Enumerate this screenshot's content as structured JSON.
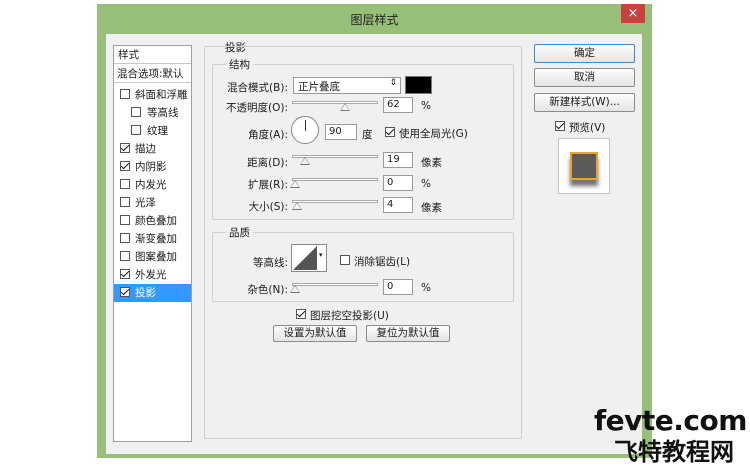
{
  "window": {
    "title": "图层样式",
    "close_glyph": "×",
    "frame_color": "#97bf79",
    "close_color": "#c9413e"
  },
  "style_list": {
    "header": "样式",
    "blend_options": "混合选项:默认",
    "items": [
      {
        "label": "斜面和浮雕",
        "checked": false,
        "indent": false,
        "selected": false
      },
      {
        "label": "等高线",
        "checked": false,
        "indent": true,
        "selected": false
      },
      {
        "label": "纹理",
        "checked": false,
        "indent": true,
        "selected": false
      },
      {
        "label": "描边",
        "checked": true,
        "indent": false,
        "selected": false
      },
      {
        "label": "内阴影",
        "checked": true,
        "indent": false,
        "selected": false
      },
      {
        "label": "内发光",
        "checked": false,
        "indent": false,
        "selected": false
      },
      {
        "label": "光泽",
        "checked": false,
        "indent": false,
        "selected": false
      },
      {
        "label": "颜色叠加",
        "checked": false,
        "indent": false,
        "selected": false
      },
      {
        "label": "渐变叠加",
        "checked": false,
        "indent": false,
        "selected": false
      },
      {
        "label": "图案叠加",
        "checked": false,
        "indent": false,
        "selected": false
      },
      {
        "label": "外发光",
        "checked": true,
        "indent": false,
        "selected": false
      },
      {
        "label": "投影",
        "checked": true,
        "indent": false,
        "selected": true
      }
    ]
  },
  "drop_shadow": {
    "section_title": "投影",
    "structure": {
      "title": "结构",
      "blend_mode_label": "混合模式(B):",
      "blend_mode_value": "正片叠底",
      "shadow_color": "#000000",
      "opacity_label": "不透明度(O):",
      "opacity_value": "62",
      "opacity_unit": "%",
      "opacity_level": 0.62,
      "angle_label": "角度(A):",
      "angle_value": "90",
      "angle_unit": "度",
      "global_light_label": "使用全局光(G)",
      "global_light_checked": true,
      "distance_label": "距离(D):",
      "distance_value": "19",
      "distance_unit": "像素",
      "distance_level": 0.12,
      "spread_label": "扩展(R):",
      "spread_value": "0",
      "spread_unit": "%",
      "spread_level": 0,
      "size_label": "大小(S):",
      "size_value": "4",
      "size_unit": "像素",
      "size_level": 0.02
    },
    "quality": {
      "title": "品质",
      "contour_label": "等高线:",
      "anti_alias_label": "消除锯齿(L)",
      "anti_alias_checked": false,
      "noise_label": "杂色(N):",
      "noise_value": "0",
      "noise_unit": "%",
      "noise_level": 0
    },
    "knockout_label": "图层挖空投影(U)",
    "knockout_checked": true,
    "make_default_label": "设置为默认值",
    "reset_default_label": "复位为默认值"
  },
  "actions": {
    "ok_label": "确定",
    "cancel_label": "取消",
    "new_style_label": "新建样式(W)...",
    "preview_label": "预览(V)",
    "preview_checked": true
  },
  "watermark": {
    "domain": "fevte.com",
    "chinese": "飞特教程网"
  }
}
